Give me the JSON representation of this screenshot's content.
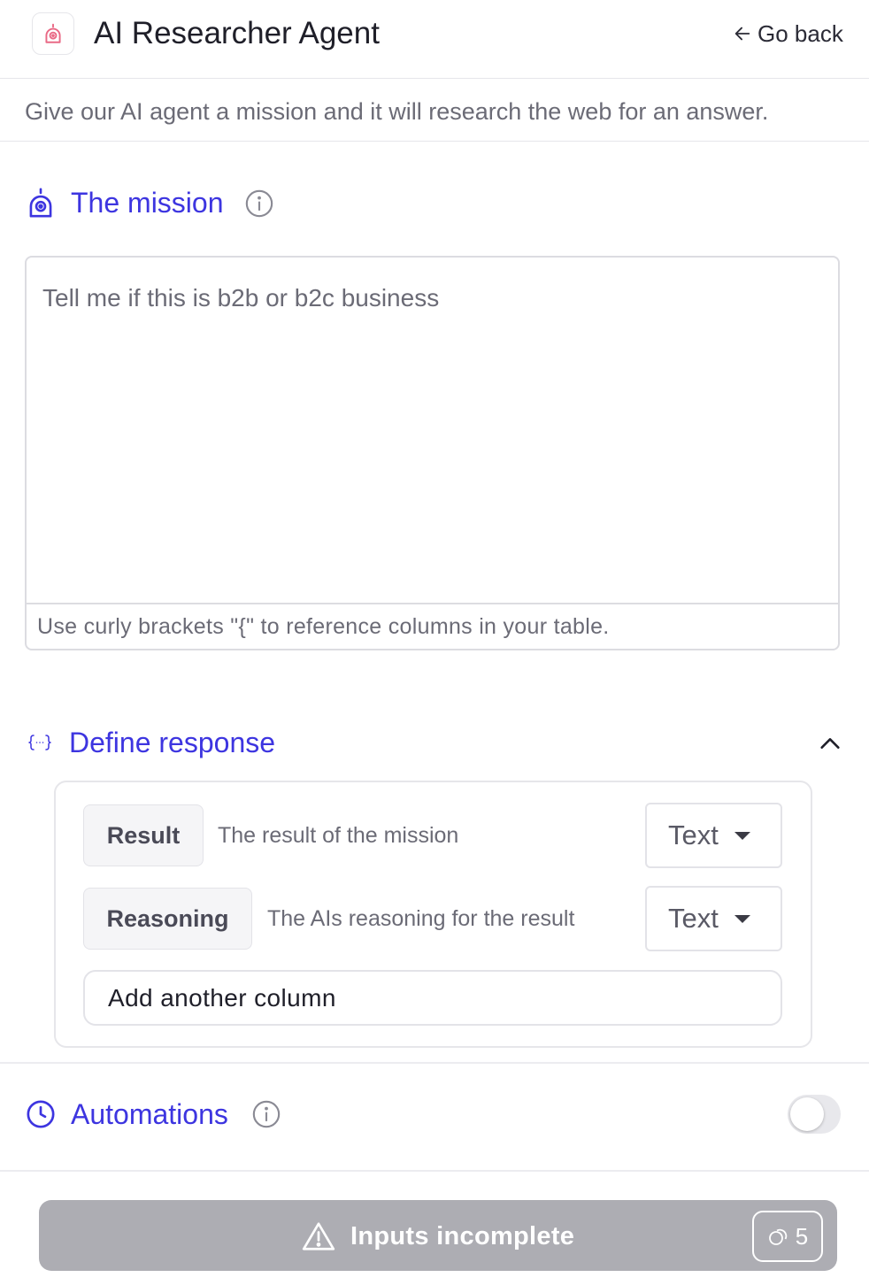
{
  "header": {
    "title": "AI Researcher Agent",
    "go_back_label": "Go back"
  },
  "subtitle": "Give our AI agent a mission and it will research the web for an answer.",
  "mission": {
    "section_title": "The mission",
    "value": "Tell me if this is b2b or b2c business",
    "hint": "Use curly brackets \"{\" to reference columns in your table."
  },
  "response": {
    "section_title": "Define response",
    "columns": [
      {
        "name": "Result",
        "description": "The result of the mission",
        "type": "Text"
      },
      {
        "name": "Reasoning",
        "description": "The AIs reasoning for the result",
        "type": "Text"
      }
    ],
    "add_column_label": "Add another column"
  },
  "automations": {
    "section_title": "Automations",
    "enabled": false
  },
  "footer": {
    "button_label": "Inputs incomplete",
    "credits": "5"
  },
  "colors": {
    "accent": "#3d35e0",
    "app_icon": "#e96a86",
    "button_disabled": "#adadb3"
  }
}
